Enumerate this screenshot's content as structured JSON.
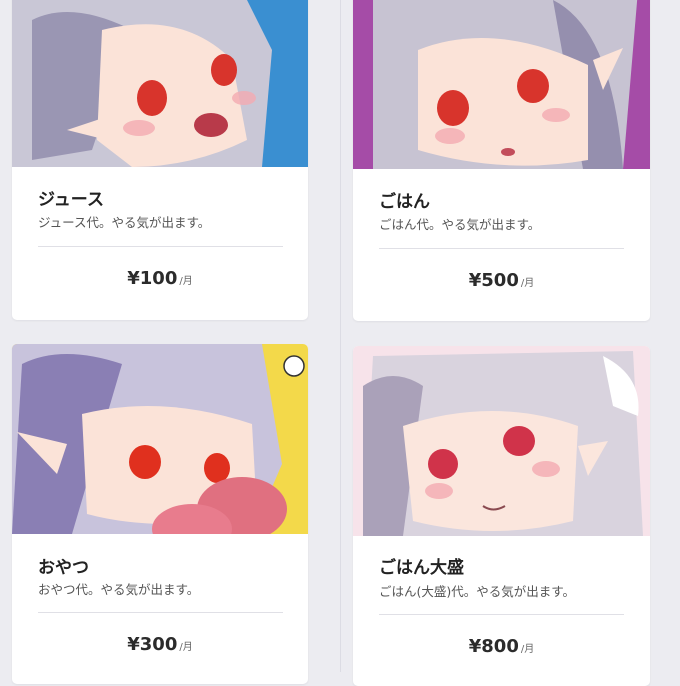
{
  "plans": [
    {
      "id": "juice",
      "title": "ジュース",
      "description": "ジュース代。やる気が出ます。",
      "price": "¥100",
      "unit": "/月",
      "bg": "#3a8fd1",
      "hair": "#c9c7d6",
      "hair_shade": "#9a96b3",
      "skin": "#fbe3d8",
      "eye": "#d8342c"
    },
    {
      "id": "gohan",
      "title": "ごはん",
      "description": "ごはん代。やる気が出ます。",
      "price": "¥500",
      "unit": "/月",
      "bg": "#a54ca7",
      "hair": "#c7c3d2",
      "hair_shade": "#958fae",
      "skin": "#fbe3d8",
      "eye": "#d8342c"
    },
    {
      "id": "oyatsu",
      "title": "おやつ",
      "description": "おやつ代。やる気が出ます。",
      "price": "¥300",
      "unit": "/月",
      "bg": "#f3d94a",
      "hair": "#c8c3dc",
      "hair_shade": "#8a7fb4",
      "skin": "#fbe3d8",
      "eye": "#e0301e"
    },
    {
      "id": "gohan-oomori",
      "title": "ごはん大盛",
      "description": "ごはん(大盛)代。やる気が出ます。",
      "price": "¥800",
      "unit": "/月",
      "bg": "#f7e3ea",
      "hair": "#d9d3de",
      "hair_shade": "#aaa1b9",
      "skin": "#fbe6dd",
      "eye": "#d0334a"
    }
  ]
}
